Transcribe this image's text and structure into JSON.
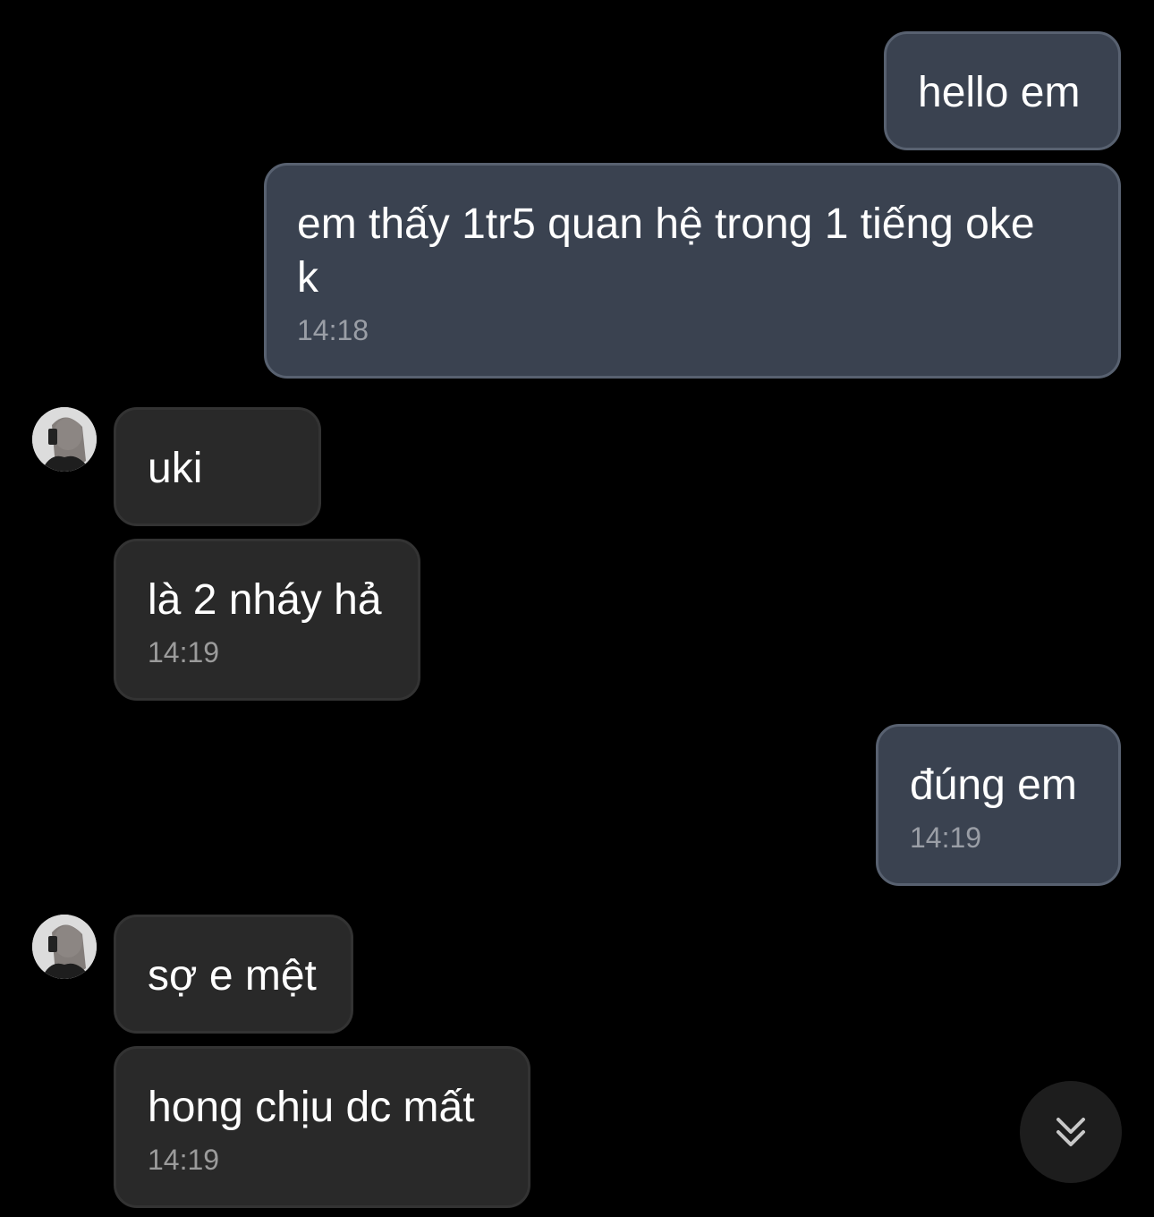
{
  "messages": [
    {
      "direction": "outgoing",
      "text": "hello em"
    },
    {
      "direction": "outgoing",
      "text": "em thấy 1tr5 quan hệ trong 1 tiếng oke\nk",
      "time": "14:18"
    },
    {
      "direction": "incoming",
      "text": "uki"
    },
    {
      "direction": "incoming",
      "text": "là 2 nháy hả",
      "time": "14:19"
    },
    {
      "direction": "outgoing",
      "text": "đúng em",
      "time": "14:19"
    },
    {
      "direction": "incoming",
      "text": "sợ e mệt"
    },
    {
      "direction": "incoming",
      "text": "hong chịu dc mất",
      "time": "14:19"
    }
  ],
  "icons": {
    "scroll_down": "double-chevron-down-icon",
    "avatar": "contact-avatar"
  },
  "colors": {
    "background": "#000000",
    "outgoing_bubble": "#3a4250",
    "incoming_bubble": "#292929",
    "timestamp": "#9a9ea6"
  }
}
